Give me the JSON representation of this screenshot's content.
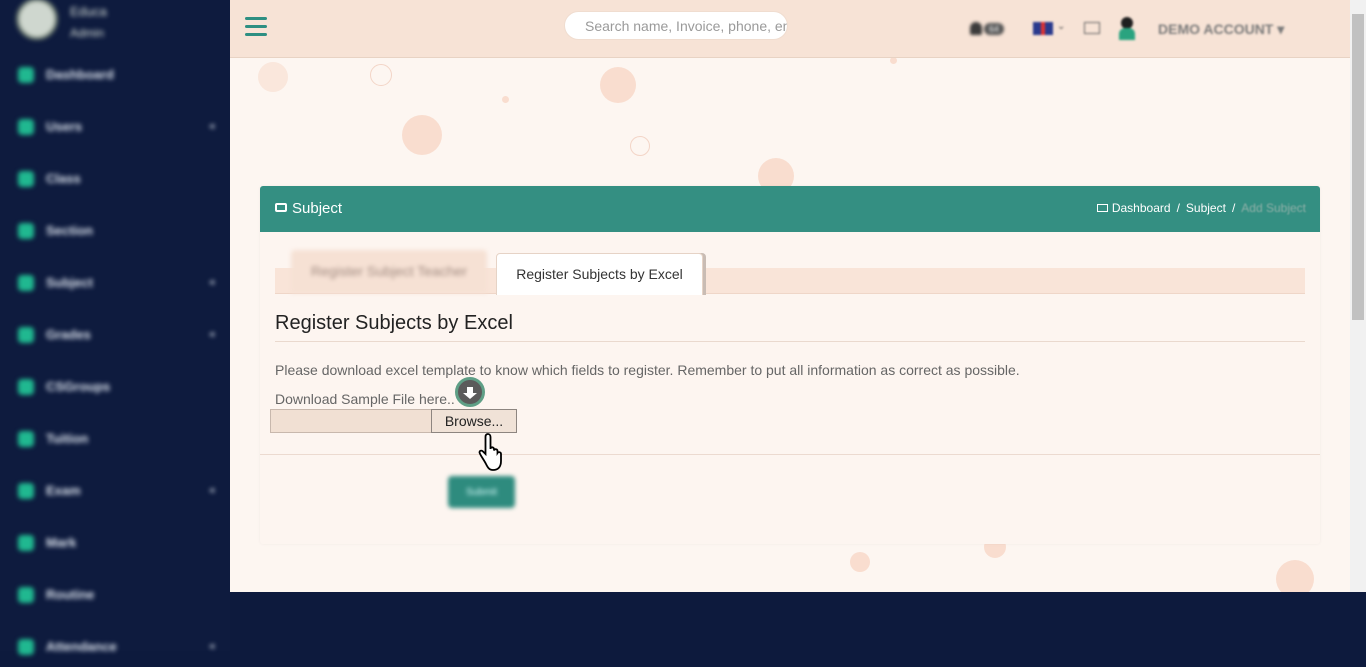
{
  "sidebar": {
    "brand": {
      "line1": "Educa",
      "line2": "Admin"
    },
    "items": [
      {
        "label": "Dashboard",
        "icon": "home-icon",
        "has_submenu": false
      },
      {
        "label": "Users",
        "icon": "users-icon",
        "has_submenu": true
      },
      {
        "label": "Class",
        "icon": "class-icon",
        "has_submenu": false
      },
      {
        "label": "Section",
        "icon": "section-icon",
        "has_submenu": false
      },
      {
        "label": "Subject",
        "icon": "book-icon",
        "has_submenu": true
      },
      {
        "label": "Grades",
        "icon": "grades-icon",
        "has_submenu": true
      },
      {
        "label": "CSGroups",
        "icon": "group-icon",
        "has_submenu": false
      },
      {
        "label": "Tuition",
        "icon": "tuition-icon",
        "has_submenu": false
      },
      {
        "label": "Exam",
        "icon": "exam-icon",
        "has_submenu": true
      },
      {
        "label": "Mark",
        "icon": "mark-icon",
        "has_submenu": false
      },
      {
        "label": "Routine",
        "icon": "routine-icon",
        "has_submenu": false
      },
      {
        "label": "Attendance",
        "icon": "attendance-icon",
        "has_submenu": true
      }
    ]
  },
  "topbar": {
    "search_placeholder": "Search name, Invoice, phone, email",
    "notification_count": "64",
    "account_name": "DEMO ACCOUNT",
    "account_chevron": "▾"
  },
  "panel": {
    "title": "Subject",
    "breadcrumb": {
      "home": "Dashboard",
      "middle": "Subject",
      "current": "Add Subject",
      "separator": "/"
    }
  },
  "tabs": [
    {
      "label": "Register Subject Teacher",
      "active": false
    },
    {
      "label": "Register Subjects by Excel",
      "active": true
    }
  ],
  "content": {
    "heading": "Register Subjects by Excel",
    "description": "Please download excel template to know which fields to register. Remember to put all information as correct as possible.",
    "download_text": "Download Sample File here..",
    "browse_label": "Browse...",
    "submit_label": "Submit"
  },
  "colors": {
    "accent": "#348f82",
    "sidebar_bg": "#0e1b3e",
    "topbar_bg": "#f7e3d6",
    "page_bg": "#fdf6f1"
  }
}
